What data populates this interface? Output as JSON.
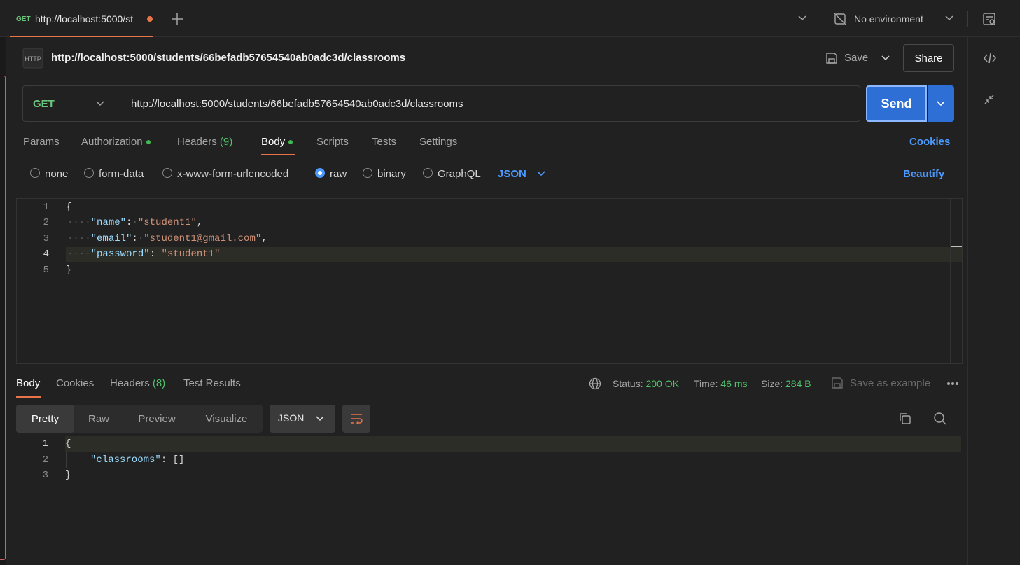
{
  "tab": {
    "method": "GET",
    "title": "http://localhost:5000/st"
  },
  "env": {
    "label": "No environment"
  },
  "request": {
    "title": "http://localhost:5000/students/66befadb57654540ab0adc3d/classrooms",
    "method": "GET",
    "url": "http://localhost:5000/students/66befadb57654540ab0adc3d/classrooms",
    "save_label": "Save",
    "share_label": "Share",
    "send_label": "Send",
    "tabs": [
      {
        "label": "Params"
      },
      {
        "label": "Authorization"
      },
      {
        "label": "Headers",
        "count": "(9)"
      },
      {
        "label": "Body"
      },
      {
        "label": "Scripts"
      },
      {
        "label": "Tests"
      },
      {
        "label": "Settings"
      }
    ],
    "cookies_label": "Cookies",
    "body_types": [
      "none",
      "form-data",
      "x-www-form-urlencoded",
      "raw",
      "binary",
      "GraphQL"
    ],
    "body_format": "JSON",
    "beautify_label": "Beautify",
    "body_lines": [
      "1",
      "2",
      "3",
      "4",
      "5"
    ],
    "body_code": {
      "l1": "{",
      "name_key": "\"name\"",
      "name_val": "\"student1\"",
      "email_key": "\"email\"",
      "email_val": "\"student1@gmail.com\"",
      "password_key": "\"password\"",
      "password_val": "\"student1\"",
      "l5": "}"
    }
  },
  "response": {
    "tabs": [
      {
        "label": "Body"
      },
      {
        "label": "Cookies"
      },
      {
        "label": "Headers",
        "count": "(8)"
      },
      {
        "label": "Test Results"
      }
    ],
    "status_label": "Status:",
    "status_value": "200 OK",
    "time_label": "Time:",
    "time_value": "46 ms",
    "size_label": "Size:",
    "size_value": "284 B",
    "save_example_label": "Save as example",
    "views": [
      "Pretty",
      "Raw",
      "Preview",
      "Visualize"
    ],
    "format": "JSON",
    "lines": [
      "1",
      "2",
      "3"
    ],
    "code": {
      "l1": "{",
      "key": "\"classrooms\"",
      "val": "[]",
      "l3": "}"
    }
  },
  "colors": {
    "accent": "#e8744a",
    "send": "#2e6fd6",
    "link": "#4c9aff",
    "ok": "#4fc36a"
  }
}
